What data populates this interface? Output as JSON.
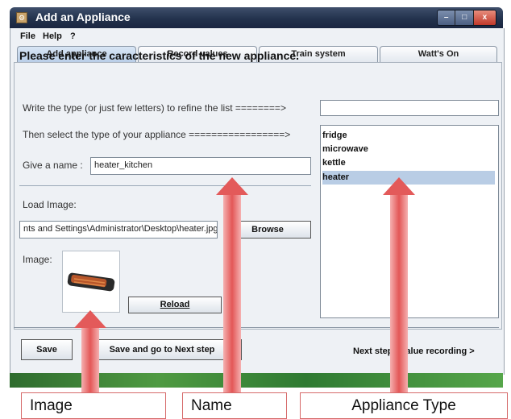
{
  "window": {
    "title": "Add an Appliance",
    "min_glyph": "–",
    "max_glyph": "□",
    "close_glyph": "x"
  },
  "menu": [
    "File",
    "Help",
    "?"
  ],
  "tabs": [
    "Add appliance",
    "Record values",
    "Train system",
    "Watt's On"
  ],
  "form": {
    "heading": "Please enter the caracteristics of the new appliance.",
    "filter_label": "Write the type (or just few letters) to refine the list  ========>",
    "filter_value": "",
    "select_label": "Then select the type of your appliance  =================>",
    "name_label": "Give a name :",
    "name_value": "heater_kitchen",
    "load_image_label": "Load Image:",
    "image_path": "nts and Settings\\Administrator\\Desktop\\heater.jpg",
    "browse_button": "Browse",
    "image_label": "Image:",
    "reload_button": "Reload"
  },
  "appliance_list": {
    "items": [
      "fridge",
      "microwave",
      "kettle",
      "heater"
    ],
    "selected": "heater"
  },
  "footer": {
    "save_button": "Save",
    "save_next_button": "Save and go to Next step",
    "next_step_link": "Next step : value recording  >"
  },
  "annotations": {
    "image": "Image",
    "name": "Name",
    "appliance_type": "Appliance Type"
  },
  "colors": {
    "arrow": "#e35757",
    "selection": "#b9cde5",
    "title_bar": "#23324d"
  }
}
